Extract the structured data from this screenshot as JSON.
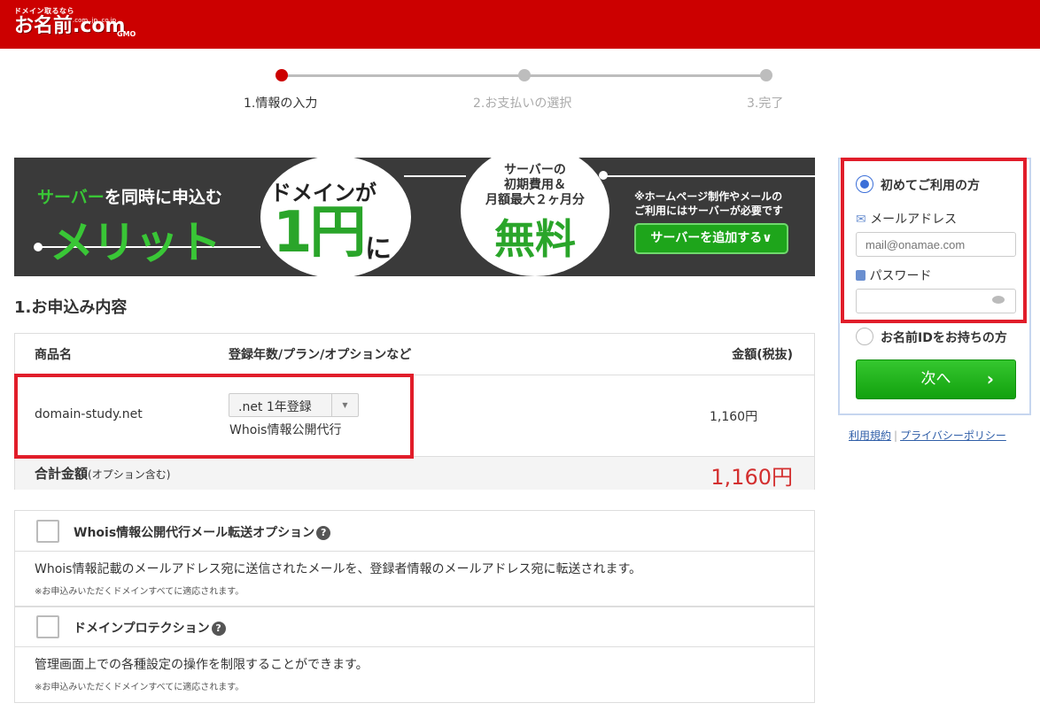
{
  "header": {
    "logo_tagline": "ドメイン取るなら",
    "logo_text": "お名前.com",
    "logo_tlds": ".com .jp .co.jp",
    "logo_company": "GMO",
    "bg_color": "#cc0000"
  },
  "steps": [
    {
      "label": "1.情報の入力",
      "active": true
    },
    {
      "label": "2.お支払いの選択",
      "active": false
    },
    {
      "label": "3.完了",
      "active": false
    }
  ],
  "banner": {
    "left_line1_accent": "サーバー",
    "left_line1_rest": "を同時に申込む",
    "left_line2": "メリット",
    "circle1_line1": "ドメインが",
    "circle1_price": "1円",
    "circle1_suffix": "に",
    "circle2_lines": "サーバーの\n初期費用＆\n月額最大２ヶ月分",
    "circle2_big": "無料",
    "right_note_line1": "※ホームページ制作やメールの",
    "right_note_line2": "ご利用にはサーバーが必要です",
    "add_server_button": "サーバーを追加する∨"
  },
  "section_title": "1.お申込み内容",
  "order_table": {
    "headers": {
      "product": "商品名",
      "plan": "登録年数/プラン/オプションなど",
      "price": "金額(税抜)"
    },
    "row": {
      "domain": "domain-study.net",
      "plan_select": ".net 1年登録",
      "plan_option": "Whois情報公開代行",
      "price": "1,160円"
    },
    "total_label": "合計金額",
    "total_note": "(オプション含む)",
    "total_value": "1,160円"
  },
  "options": [
    {
      "title": "Whois情報公開代行メール転送オプション",
      "description": "Whois情報記載のメールアドレス宛に送信されたメールを、登録者情報のメールアドレス宛に転送されます。",
      "note": "※お申込みいただくドメインすべてに適応されます。",
      "checked": false
    },
    {
      "title": "ドメインプロテクション",
      "description": "管理画面上での各種設定の操作を制限することができます。",
      "note": "※お申込みいただくドメインすべてに適応されます。",
      "checked": false
    }
  ],
  "login_panel": {
    "first_time_label": "初めてご利用の方",
    "email_label": "メールアドレス",
    "email_placeholder": "mail@onamae.com",
    "password_label": "パスワード",
    "has_id_label": "お名前IDをお持ちの方",
    "next_button": "次へ",
    "selected": "first_time"
  },
  "footer_links": {
    "terms": "利用規約",
    "separator": "|",
    "privacy": "プライバシーポリシー"
  },
  "colors": {
    "highlight": "#e11d2a",
    "total_price": "#d32f2f",
    "next_button": "#1ea51b",
    "link": "#2f5ea8"
  }
}
